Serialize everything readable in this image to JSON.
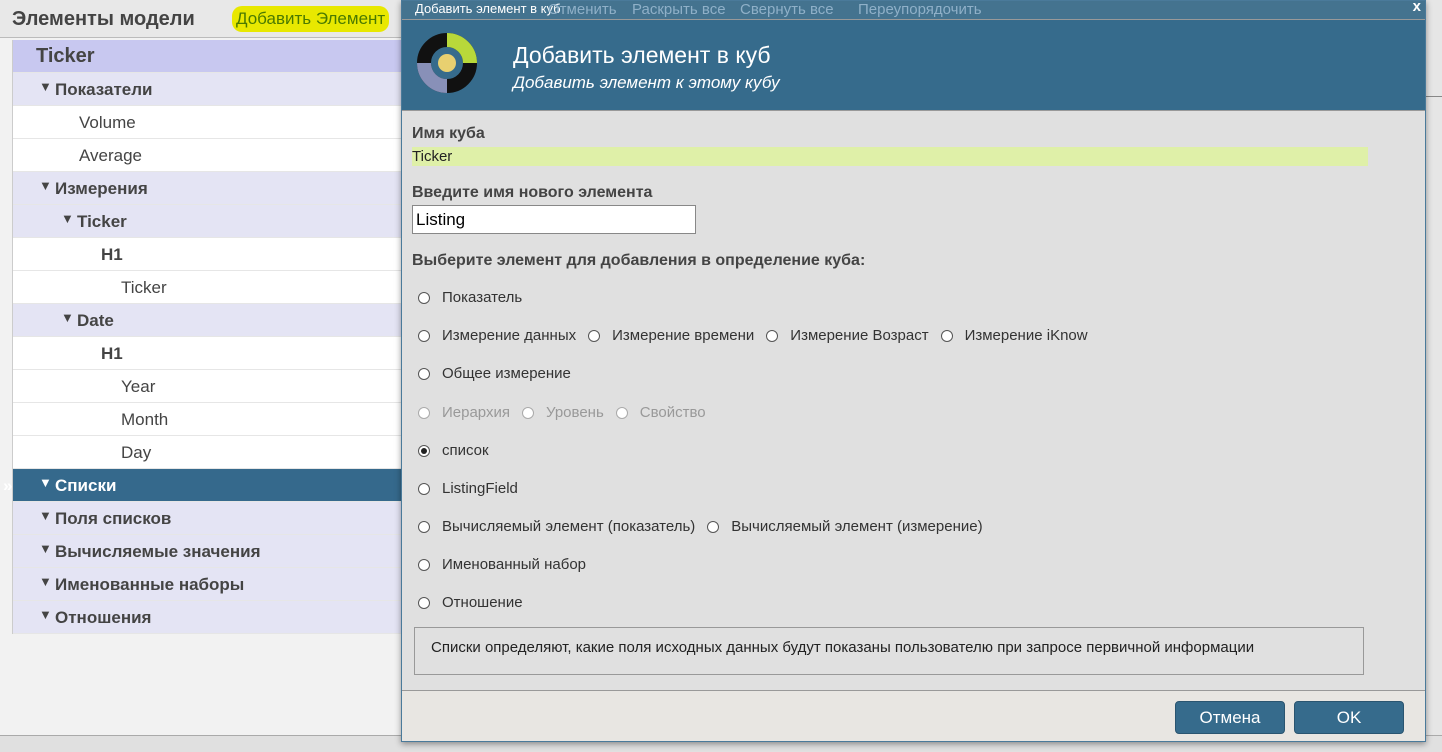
{
  "header": {
    "title": "Элементы модели",
    "add_element": "Добавить Элемент",
    "bg_toolbar": [
      "Отменить",
      "Раскрыть все",
      "Свернуть все",
      "Переупорядочить"
    ]
  },
  "tree": {
    "cube": "Ticker",
    "items": [
      {
        "label": "Показатели",
        "type": "group",
        "indent": 1
      },
      {
        "label": "Volume",
        "type": "leaf",
        "indent": 3
      },
      {
        "label": "Average",
        "type": "leaf",
        "indent": 3
      },
      {
        "label": "Измерения",
        "type": "group",
        "indent": 1
      },
      {
        "label": "Ticker",
        "type": "group",
        "indent": 2
      },
      {
        "label": "H1",
        "type": "hier",
        "indent": 4
      },
      {
        "label": "Ticker",
        "type": "leaf",
        "indent": 5
      },
      {
        "label": "Date",
        "type": "group",
        "indent": 2
      },
      {
        "label": "H1",
        "type": "hier",
        "indent": 4
      },
      {
        "label": "Year",
        "type": "leaf",
        "indent": 5
      },
      {
        "label": "Month",
        "type": "leaf",
        "indent": 5
      },
      {
        "label": "Day",
        "type": "leaf",
        "indent": 5
      },
      {
        "label": "Списки",
        "type": "selected",
        "indent": 1
      },
      {
        "label": "Поля списков",
        "type": "group",
        "indent": 1
      },
      {
        "label": "Вычисляемые значения",
        "type": "group",
        "indent": 1
      },
      {
        "label": "Именованные наборы",
        "type": "group",
        "indent": 1
      },
      {
        "label": "Отношения",
        "type": "group",
        "indent": 1
      }
    ]
  },
  "dialog": {
    "window_title": "Добавить элемент в куб",
    "close": "x",
    "title": "Добавить элемент в куб",
    "subtitle": "Добавить элемент к этому кубу",
    "cube_name_label": "Имя куба",
    "cube_name": "Ticker",
    "new_name_label": "Введите имя нового элемента",
    "new_name": "Listing",
    "choose_label": "Выберите элемент для добавления в определение куба:",
    "options": [
      [
        {
          "label": "Показатель"
        }
      ],
      [
        {
          "label": "Измерение данных"
        },
        {
          "label": "Измерение времени"
        },
        {
          "label": "Измерение Возраст"
        },
        {
          "label": "Измерение iKnow"
        }
      ],
      [
        {
          "label": "Общее измерение"
        }
      ],
      [
        {
          "label": "Иерархия",
          "disabled": true
        },
        {
          "label": "Уровень",
          "disabled": true
        },
        {
          "label": "Свойство",
          "disabled": true
        }
      ],
      [
        {
          "label": "список",
          "checked": true
        }
      ],
      [
        {
          "label": "ListingField"
        }
      ],
      [
        {
          "label": "Вычисляемый элемент (показатель)"
        },
        {
          "label": "Вычисляемый элемент (измерение)"
        }
      ],
      [
        {
          "label": "Именованный набор"
        }
      ],
      [
        {
          "label": "Отношение"
        }
      ]
    ],
    "description": "Списки определяют, какие поля исходных данных будут показаны пользователю при запросе первичной информации",
    "cancel": "Отмена",
    "ok": "OK"
  },
  "colors": {
    "accent": "#366b8c",
    "highlight": "#e8e800",
    "cube_name_bg": "#dff0a8"
  }
}
